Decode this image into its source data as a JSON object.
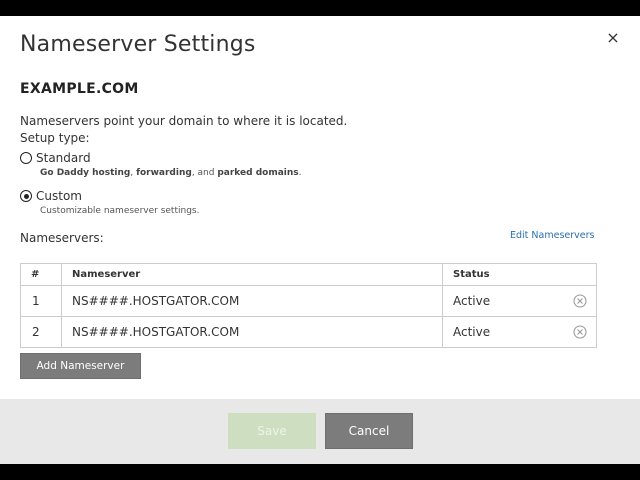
{
  "dialog": {
    "title": "Nameserver Settings",
    "close_glyph": "×"
  },
  "domain": "EXAMPLE.COM",
  "intro": "Nameservers point your domain to where it is located.",
  "setup_type_label": "Setup type:",
  "setup_options": [
    {
      "label": "Standard",
      "selected": false,
      "description": [
        {
          "text": "Go Daddy hosting",
          "bold": true
        },
        {
          "text": ", ",
          "bold": false
        },
        {
          "text": "forwarding",
          "bold": true
        },
        {
          "text": ", and ",
          "bold": false
        },
        {
          "text": "parked domains",
          "bold": true
        },
        {
          "text": ".",
          "bold": false
        }
      ]
    },
    {
      "label": "Custom",
      "selected": true,
      "description": [
        {
          "text": "Customizable nameserver settings.",
          "bold": false
        }
      ]
    }
  ],
  "nameservers_label": "Nameservers:",
  "edit_link": "Edit Nameservers",
  "table": {
    "headers": [
      "#",
      "Nameserver",
      "Status"
    ],
    "rows": [
      {
        "num": "1",
        "nameserver": "NS####.HOSTGATOR.COM",
        "status": "Active"
      },
      {
        "num": "2",
        "nameserver": "NS####.HOSTGATOR.COM",
        "status": "Active"
      }
    ]
  },
  "add_button": "Add Nameserver",
  "footer": {
    "save_label": "Save",
    "cancel_label": "Cancel"
  },
  "colors": {
    "link": "#2a6fb0",
    "button_gray": "#7c7c7c",
    "save_disabled": "#cddfc0",
    "footer_bg": "#e8e8e8"
  },
  "icons": {
    "close": "close-icon",
    "remove": "remove-circle-icon",
    "radio": "radio-icon"
  }
}
